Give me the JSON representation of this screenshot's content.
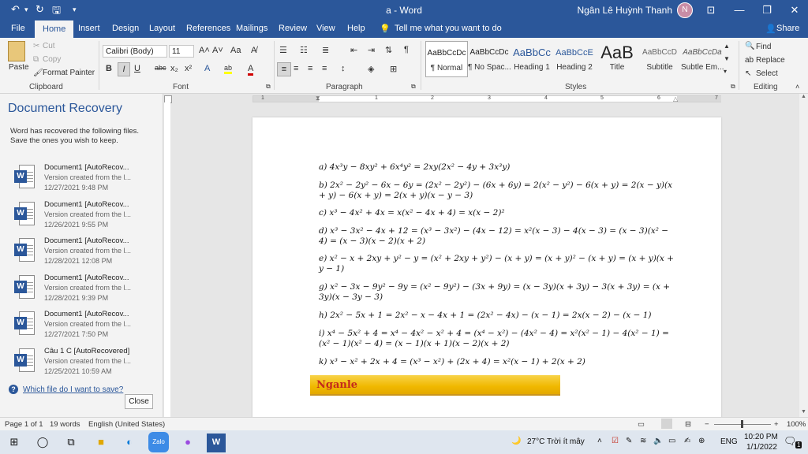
{
  "window": {
    "title": "a  -  Word",
    "user": "Ngân Lê Huỳnh Thanh",
    "minimize": "—",
    "restore": "❐",
    "close": "✕",
    "ribbon_display": "⊡",
    "avatar_initial": "N"
  },
  "quick_access": {
    "undo": "↶",
    "undo_drop": "▾",
    "redo": "↻",
    "save": "🖫",
    "customize": "▾"
  },
  "tabs": {
    "file": "File",
    "home": "Home",
    "insert": "Insert",
    "design": "Design",
    "layout": "Layout",
    "references": "References",
    "mailings": "Mailings",
    "review": "Review",
    "view": "View",
    "help": "Help",
    "tell_me": "Tell me what you want to do",
    "share": "Share"
  },
  "ribbon": {
    "clipboard": {
      "paste": "Paste",
      "cut": "Cut",
      "copy": "Copy",
      "format_painter": "Format Painter",
      "label": "Clipboard"
    },
    "font": {
      "family": "Calibri (Body)",
      "size": "11",
      "label": "Font",
      "bold": "B",
      "italic": "I",
      "underline": "U",
      "strike": "abc",
      "sub": "x₂",
      "sup": "x²",
      "grow": "A˄",
      "shrink": "A˅",
      "case": "Aa",
      "effects": "A",
      "highlight": "ab",
      "color": "A"
    },
    "paragraph": {
      "label": "Paragraph"
    },
    "styles": {
      "label": "Styles",
      "items": [
        {
          "sample": "AaBbCcDc",
          "name": "¶ Normal"
        },
        {
          "sample": "AaBbCcDc",
          "name": "¶ No Spac..."
        },
        {
          "sample": "AaBbCc",
          "name": "Heading 1"
        },
        {
          "sample": "AaBbCcE",
          "name": "Heading 2"
        },
        {
          "sample": "AaB",
          "name": "Title"
        },
        {
          "sample": "AaBbCcD",
          "name": "Subtitle"
        },
        {
          "sample": "AaBbCcDa",
          "name": "Subtle Em..."
        }
      ]
    },
    "editing": {
      "find": "Find",
      "replace": "Replace",
      "select": "Select",
      "label": "Editing"
    }
  },
  "recovery": {
    "title": "Document Recovery",
    "description": "Word has recovered the following files. Save the ones you wish to keep.",
    "items": [
      {
        "name": "Document1  [AutoRecov...",
        "sub": "Version created from the l...",
        "date": "12/27/2021 9:48 PM"
      },
      {
        "name": "Document1  [AutoRecov...",
        "sub": "Version created from the l...",
        "date": "12/26/2021 9:55 PM"
      },
      {
        "name": "Document1  [AutoRecov...",
        "sub": "Version created from the l...",
        "date": "12/28/2021 12:08 PM"
      },
      {
        "name": "Document1  [AutoRecov...",
        "sub": "Version created from the l...",
        "date": "12/28/2021 9:39 PM"
      },
      {
        "name": "Document1  [AutoRecov...",
        "sub": "Version created from the l...",
        "date": "12/27/2021 7:50 PM"
      },
      {
        "name": "Câu 1 C  [AutoRecovered]",
        "sub": "Version created from the l...",
        "date": "12/25/2021 10:59 AM"
      }
    ],
    "which_file": "Which file do I want to save?",
    "close": "Close"
  },
  "document": {
    "equations": [
      "a) 4x³y − 8xy² + 6x⁴y² = 2xy(2x² − 4y + 3x³y)",
      "b) 2x² − 2y² − 6x − 6y = (2x² − 2y²) − (6x + 6y) = 2(x² − y²) − 6(x + y) = 2(x − y)(x + y) − 6(x + y) = 2(x + y)(x − y − 3)",
      "c) x³ − 4x² + 4x = x(x² − 4x + 4) = x(x − 2)²",
      "d) x³ − 3x² − 4x + 12 = (x³ − 3x²) − (4x − 12) = x²(x − 3) − 4(x − 3) = (x − 3)(x² − 4) = (x − 3)(x − 2)(x + 2)",
      "e) x² − x + 2xy + y² − y = (x² + 2xy + y²) − (x + y) = (x + y)² − (x + y) = (x + y)(x + y − 1)",
      "g) x² − 3x − 9y² − 9y = (x² − 9y²) − (3x + 9y) = (x − 3y)(x + 3y) − 3(x + 3y) = (x + 3y)(x − 3y − 3)",
      "h) 2x² − 5x + 1 = 2x² − x − 4x + 1 = (2x² − 4x) − (x − 1) = 2x(x − 2) − (x − 1)",
      "i) x⁴ − 5x² + 4 = x⁴ − 4x² − x² + 4 = (x⁴ − x²) − (4x² − 4) = x²(x² − 1) − 4(x² − 1) = (x² − 1)(x² − 4) = (x − 1)(x + 1)(x − 2)(x + 2)",
      "k) x³ − x² + 2x + 4 = (x³ − x²) + (2x + 4) = x²(x − 1) + 2(x + 2)"
    ],
    "banner": "Nganle"
  },
  "ruler": {
    "numbers": [
      "1",
      "1",
      "2",
      "3",
      "4",
      "5",
      "6",
      "7"
    ]
  },
  "status": {
    "page": "Page 1 of 1",
    "words": "19 words",
    "language": "English (United States)",
    "zoom": "100%",
    "zoom_minus": "−",
    "zoom_plus": "+"
  },
  "taskbar": {
    "weather": "27°C  Trời ít mây",
    "ime": "ENG",
    "time": "10:20 PM",
    "date": "1/1/2022",
    "notifications": "1",
    "zalo": "Zalo"
  }
}
